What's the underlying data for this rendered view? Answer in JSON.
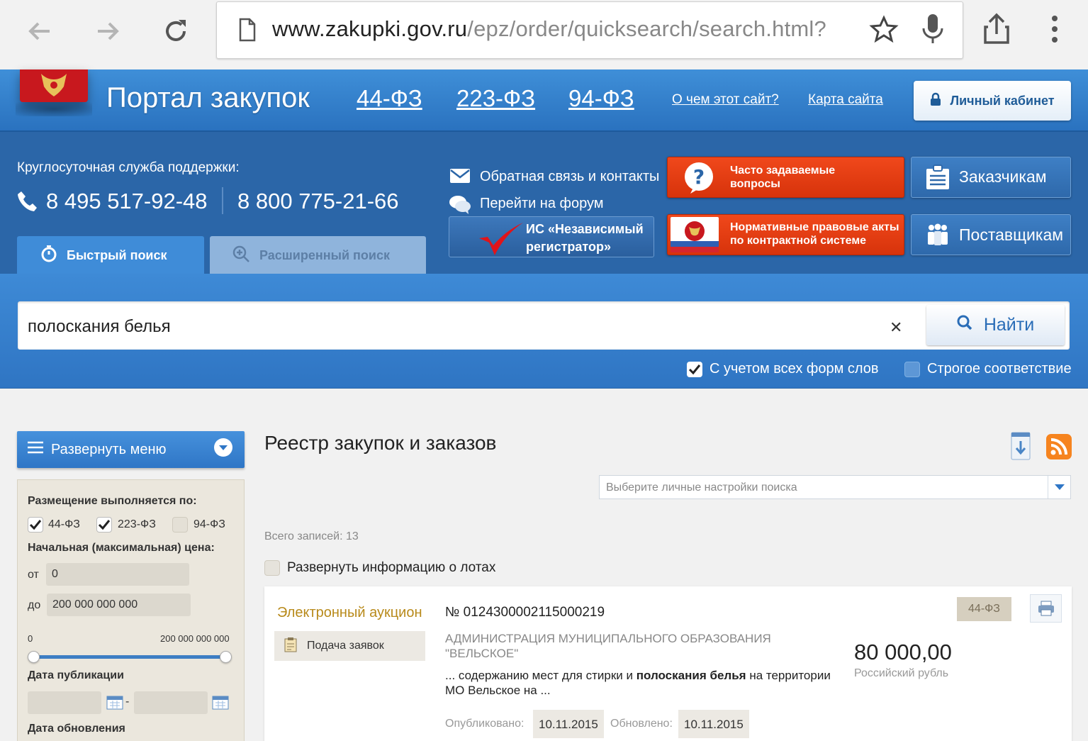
{
  "browser": {
    "url_domain": "www.zakupki.gov.ru",
    "url_path": "/epz/order/quicksearch/search.html?"
  },
  "header": {
    "portal_title": "Портал закупок",
    "laws": [
      "44-ФЗ",
      "223-ФЗ",
      "94-ФЗ"
    ],
    "about_link": "О чем этот сайт?",
    "sitemap_link": "Карта сайта",
    "cabinet_button": "Личный кабинет"
  },
  "support": {
    "title": "Круглосуточная служба поддержки:",
    "phone1": "8 495 517-92-48",
    "phone2": "8 800 775-21-66",
    "feedback_link": "Обратная связь и контакты",
    "forum_link": "Перейти на форум",
    "registrar_button": "ИС «Независимый регистратор»",
    "faq_button": "Часто задаваемые вопросы",
    "legal_button": "Нормативные правовые акты по контрактной системе",
    "customers_button": "Заказчикам",
    "suppliers_button": "Поставщикам"
  },
  "tabs": {
    "quick": "Быстрый поиск",
    "advanced": "Расширенный поиск"
  },
  "search": {
    "query": "полоскания белья",
    "find_button": "Найти",
    "all_word_forms": "С учетом всех форм слов",
    "strict_match": "Строгое соответствие"
  },
  "sidebar": {
    "menu_button": "Развернуть меню",
    "placement_label": "Размещение выполняется по:",
    "law_44": "44-ФЗ",
    "law_223": "223-ФЗ",
    "law_94": "94-ФЗ",
    "price_label": "Начальная (максимальная) цена:",
    "from_label": "от",
    "from_value": "0",
    "to_label": "до",
    "to_value": "200 000 000 000",
    "slider_min": "0",
    "slider_max": "200 000 000 000",
    "pub_date_label": "Дата публикации",
    "date_sep": "-",
    "update_date_label": "Дата обновления"
  },
  "main": {
    "title": "Реестр закупок и заказов",
    "settings_placeholder": "Выберите личные настройки поиска",
    "total": "Всего записей: 13",
    "expand_lots": "Развернуть информацию о лотах"
  },
  "result": {
    "type": "Электронный аукцион",
    "stage": "Подача заявок",
    "number": "№ 0124300002115000219",
    "organization": "АДМИНИСТРАЦИЯ МУНИЦИПАЛЬНОГО ОБРАЗОВАНИЯ \"ВЕЛЬСКОЕ\"",
    "desc_before": "... содержанию мест для стирки и ",
    "desc_highlight": "полоскания белья",
    "desc_after": " на территории МО Вельское на ...",
    "law_badge": "44-ФЗ",
    "price": "80 000,00",
    "currency": "Российский рубль",
    "published_label": "Опубликовано:",
    "published_value": "10.11.2015",
    "updated_label": "Обновлено:",
    "updated_value": "10.11.2015"
  },
  "colors": {
    "brand_blue": "#2f75c3",
    "accent_red": "#e0401a",
    "card_type_gold": "#b88a1b"
  }
}
